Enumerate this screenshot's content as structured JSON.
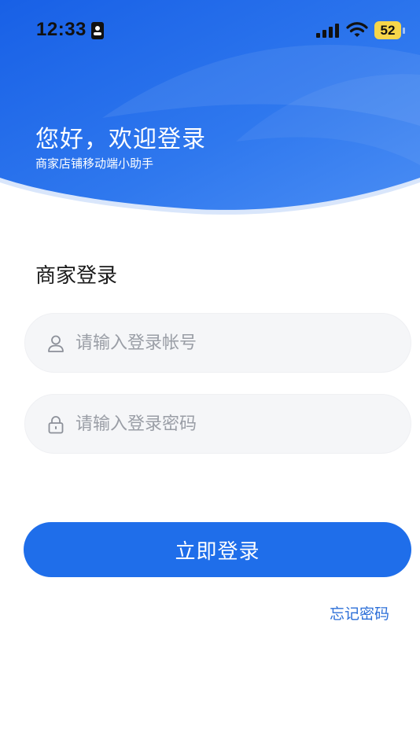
{
  "status_bar": {
    "time": "12:33",
    "battery_level": "52"
  },
  "header": {
    "greeting": "您好，欢迎登录",
    "subtitle": "商家店铺移动端小助手"
  },
  "login": {
    "section_title": "商家登录",
    "account_placeholder": "请输入登录帐号",
    "password_placeholder": "请输入登录密码",
    "submit_label": "立即登录",
    "forgot_label": "忘记密码"
  },
  "colors": {
    "primary": "#1f6eea",
    "header_start": "#1b63e6",
    "link": "#2c6fd8",
    "input_bg": "#f5f6f8",
    "battery": "#f7d64a"
  },
  "icons": {
    "status_bar": [
      "id-card-icon",
      "cellular-signal-icon",
      "wifi-icon",
      "battery-icon"
    ],
    "fields": [
      "user-icon",
      "lock-icon"
    ]
  }
}
